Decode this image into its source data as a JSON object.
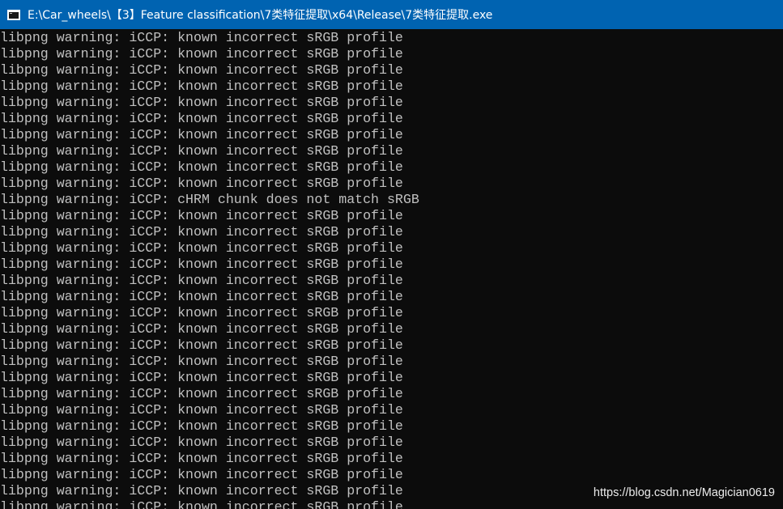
{
  "window": {
    "title": "E:\\Car_wheels\\【3】Feature classification\\7类特征提取\\x64\\Release\\7类特征提取.exe",
    "icon": "console-window-icon",
    "colors": {
      "titlebar": "#0063b1",
      "console_bg": "#0c0c0c",
      "console_text": "#c0c0c0"
    }
  },
  "console": {
    "lines": [
      "libpng warning: iCCP: known incorrect sRGB profile",
      "libpng warning: iCCP: known incorrect sRGB profile",
      "libpng warning: iCCP: known incorrect sRGB profile",
      "libpng warning: iCCP: known incorrect sRGB profile",
      "libpng warning: iCCP: known incorrect sRGB profile",
      "libpng warning: iCCP: known incorrect sRGB profile",
      "libpng warning: iCCP: known incorrect sRGB profile",
      "libpng warning: iCCP: known incorrect sRGB profile",
      "libpng warning: iCCP: known incorrect sRGB profile",
      "libpng warning: iCCP: known incorrect sRGB profile",
      "libpng warning: iCCP: cHRM chunk does not match sRGB",
      "libpng warning: iCCP: known incorrect sRGB profile",
      "libpng warning: iCCP: known incorrect sRGB profile",
      "libpng warning: iCCP: known incorrect sRGB profile",
      "libpng warning: iCCP: known incorrect sRGB profile",
      "libpng warning: iCCP: known incorrect sRGB profile",
      "libpng warning: iCCP: known incorrect sRGB profile",
      "libpng warning: iCCP: known incorrect sRGB profile",
      "libpng warning: iCCP: known incorrect sRGB profile",
      "libpng warning: iCCP: known incorrect sRGB profile",
      "libpng warning: iCCP: known incorrect sRGB profile",
      "libpng warning: iCCP: known incorrect sRGB profile",
      "libpng warning: iCCP: known incorrect sRGB profile",
      "libpng warning: iCCP: known incorrect sRGB profile",
      "libpng warning: iCCP: known incorrect sRGB profile",
      "libpng warning: iCCP: known incorrect sRGB profile",
      "libpng warning: iCCP: known incorrect sRGB profile",
      "libpng warning: iCCP: known incorrect sRGB profile",
      "libpng warning: iCCP: known incorrect sRGB profile",
      "libpng warning: iCCP: known incorrect sRGB profile"
    ]
  },
  "watermark": {
    "text": "https://blog.csdn.net/Magician0619"
  }
}
